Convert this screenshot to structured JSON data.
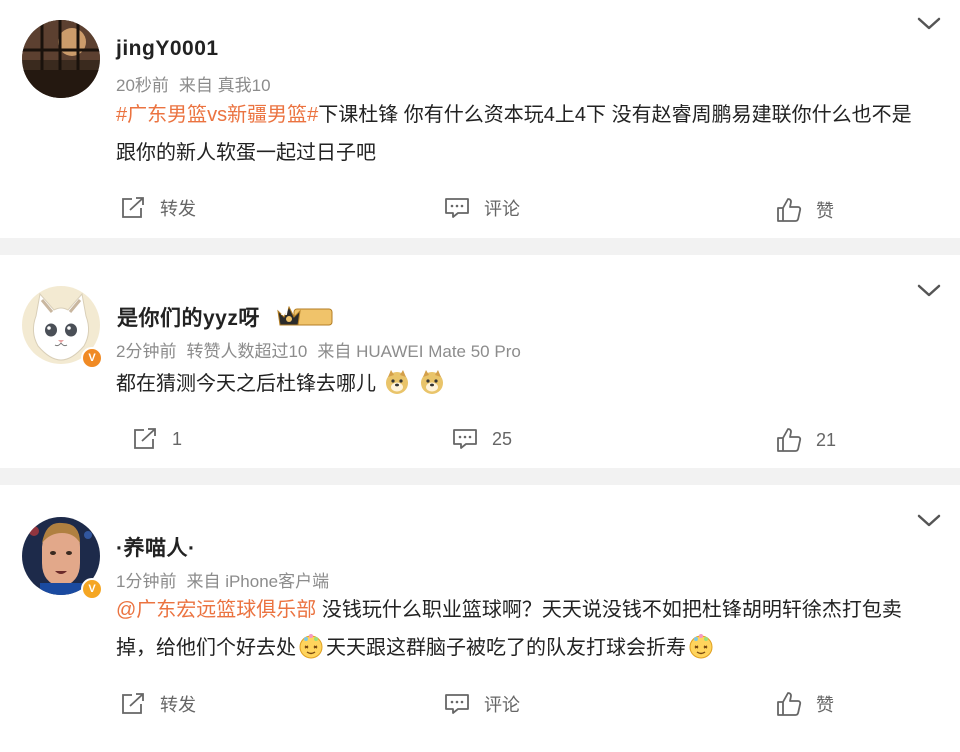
{
  "posts": [
    {
      "username": "jingY0001",
      "time": "20秒前",
      "source": "来自 真我10",
      "hashtag": "#广东男篮vs新疆男篮#",
      "text": "下课杜锋 你有什么资本玩4上4下 没有赵睿周鹏易建联你什么也不是 跟你的新人软蛋一起过日子吧",
      "repost_label": "转发",
      "comment_label": "评论",
      "like_label": "赞"
    },
    {
      "username": "是你们的yyz呀",
      "level_badge": "II",
      "time": "2分钟前",
      "extra": "转赞人数超过10",
      "source": "来自 HUAWEI Mate 50 Pro",
      "text": "都在猜测今天之后杜锋去哪儿",
      "repost_count": "1",
      "comment_count": "25",
      "like_count": "21"
    },
    {
      "username": "·养喵人·",
      "time": "1分钟前",
      "source": "来自 iPhone客户端",
      "mention": "@广东宏远篮球俱乐部",
      "text1": " 没钱玩什么职业篮球啊？天天说没钱不如把杜锋胡明轩徐杰打包卖掉，给他们个好去处",
      "text2": "天天跟这群脑子被吃了的队友打球会折寿",
      "repost_label": "转发",
      "comment_label": "评论",
      "like_label": "赞"
    }
  ],
  "colors": {
    "accent": "#eb7340",
    "verified": "#f5a623",
    "separator": "#f2f2f2"
  }
}
